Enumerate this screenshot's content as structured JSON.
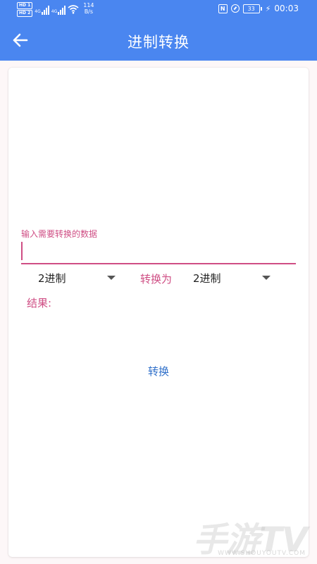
{
  "status_bar": {
    "hd1": "HD",
    "hd1_slot": "1",
    "hd2": "HD",
    "hd2_slot": "2",
    "net1": "4G",
    "net2": "4G",
    "speed_value": "114",
    "speed_unit": "B/s",
    "nfc": "N",
    "battery_level": "33",
    "time": "00:03"
  },
  "app_bar": {
    "title": "进制转换"
  },
  "form": {
    "input_label": "输入需要转换的数据",
    "input_value": "",
    "from_base": "2进制",
    "convert_to_label": "转换为",
    "to_base": "2进制",
    "result_label": "结果:",
    "result_value": "",
    "convert_button": "转换"
  },
  "watermark": {
    "main": "手游TV",
    "sub": "WWW.SHOUYOUTV.COM"
  },
  "colors": {
    "primary": "#4a86f0",
    "accent": "#cf4e84",
    "button_text": "#2f6fc9",
    "background": "#fdf7f8"
  }
}
